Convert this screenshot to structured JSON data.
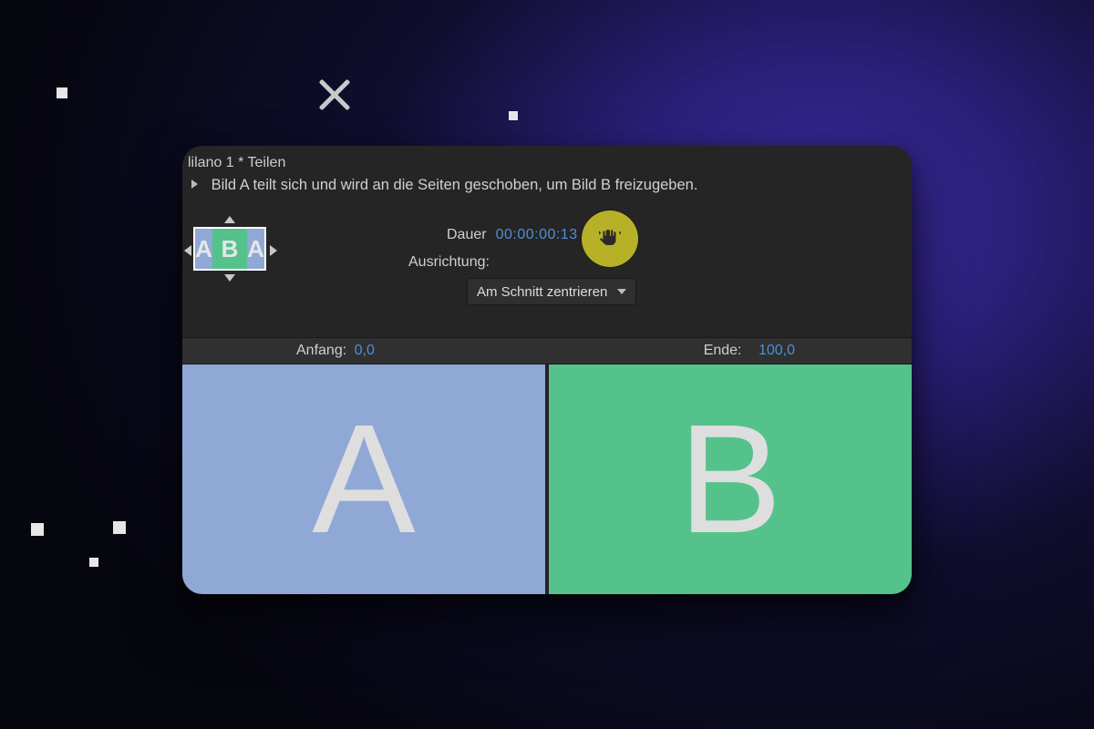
{
  "title": "lilano 1 * Teilen",
  "description": "Bild A teilt sich und wird an die Seiten geschoben, um Bild B freizugeben.",
  "fields": {
    "duration_label": "Dauer",
    "duration_value": "00:00:00:13",
    "alignment_label": "Ausrichtung:",
    "alignment_value": "Am Schnitt zentrieren"
  },
  "range": {
    "start_label": "Anfang:",
    "start_value": "0,0",
    "end_label": "Ende:",
    "end_value": "100,0"
  },
  "thumb": {
    "a": "A",
    "b": "B"
  },
  "preview": {
    "a": "A",
    "b": "B"
  },
  "colors": {
    "panel_bg": "#252525",
    "link_blue": "#4f8fd6",
    "tile_a": "#8fa8d6",
    "tile_b": "#55c28c",
    "highlight": "#b7b128"
  }
}
